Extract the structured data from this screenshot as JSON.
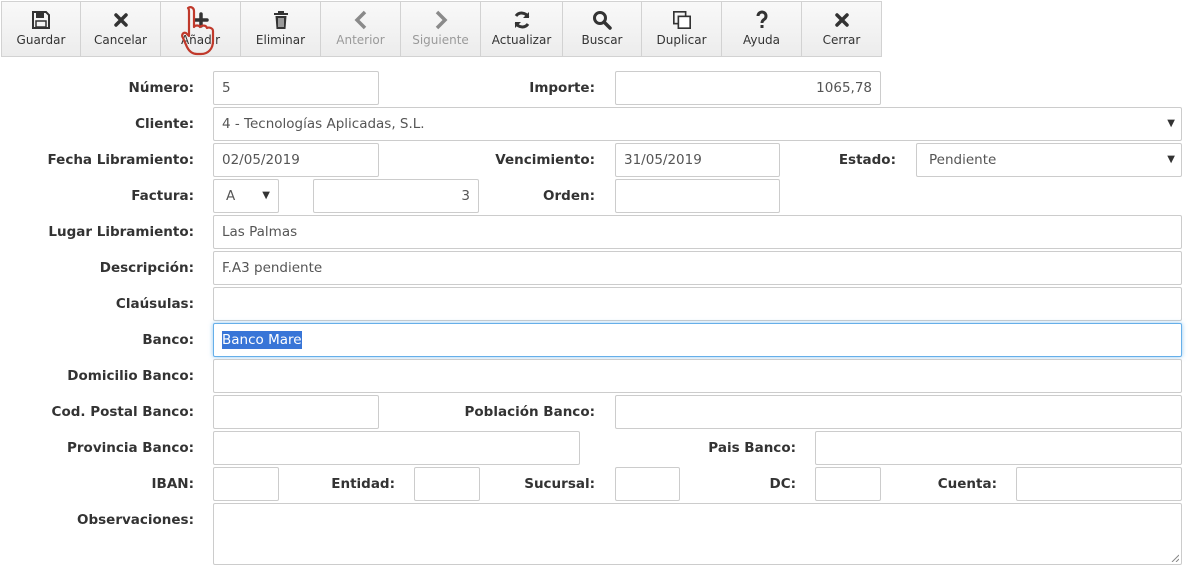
{
  "toolbar": {
    "buttons": [
      {
        "label": "Guardar",
        "icon": "save-icon",
        "enabled": true
      },
      {
        "label": "Cancelar",
        "icon": "close-icon",
        "enabled": true
      },
      {
        "label": "Añadir",
        "icon": "plus-icon",
        "enabled": true
      },
      {
        "label": "Eliminar",
        "icon": "trash-icon",
        "enabled": true
      },
      {
        "label": "Anterior",
        "icon": "chevron-left-icon",
        "enabled": false
      },
      {
        "label": "Siguiente",
        "icon": "chevron-right-icon",
        "enabled": false
      },
      {
        "label": "Actualizar",
        "icon": "refresh-icon",
        "enabled": true
      },
      {
        "label": "Buscar",
        "icon": "search-icon",
        "enabled": true
      },
      {
        "label": "Duplicar",
        "icon": "copy-icon",
        "enabled": true
      },
      {
        "label": "Ayuda",
        "icon": "question-icon",
        "enabled": true
      },
      {
        "label": "Cerrar",
        "icon": "close-icon",
        "enabled": true
      }
    ]
  },
  "form": {
    "numero": {
      "label": "Número:",
      "value": "5"
    },
    "importe": {
      "label": "Importe:",
      "value": "1065,78"
    },
    "cliente": {
      "label": "Cliente:",
      "value": "4 - Tecnologías Aplicadas, S.L."
    },
    "fecha_libramiento": {
      "label": "Fecha Libramiento:",
      "value": "02/05/2019"
    },
    "vencimiento": {
      "label": "Vencimiento:",
      "value": "31/05/2019"
    },
    "estado": {
      "label": "Estado:",
      "value": "Pendiente"
    },
    "factura": {
      "label": "Factura:",
      "serie": "A",
      "numero": "3"
    },
    "orden": {
      "label": "Orden:",
      "value": ""
    },
    "lugar_libramiento": {
      "label": "Lugar Libramiento:",
      "value": "Las Palmas"
    },
    "descripcion": {
      "label": "Descripción:",
      "value": "F.A3 pendiente"
    },
    "clausulas": {
      "label": "Claúsulas:",
      "value": ""
    },
    "banco": {
      "label": "Banco:",
      "value": "Banco Mare"
    },
    "domicilio_banco": {
      "label": "Domicilio Banco:",
      "value": ""
    },
    "cod_postal_banco": {
      "label": "Cod. Postal Banco:",
      "value": ""
    },
    "poblacion_banco": {
      "label": "Población Banco:",
      "value": ""
    },
    "provincia_banco": {
      "label": "Provincia Banco:",
      "value": ""
    },
    "pais_banco": {
      "label": "Pais Banco:",
      "value": ""
    },
    "iban": {
      "label": "IBAN:",
      "value": ""
    },
    "entidad": {
      "label": "Entidad:",
      "value": ""
    },
    "sucursal": {
      "label": "Sucursal:",
      "value": ""
    },
    "dc": {
      "label": "DC:",
      "value": ""
    },
    "cuenta": {
      "label": "Cuenta:",
      "value": ""
    },
    "observaciones": {
      "label": "Observaciones:",
      "value": ""
    }
  },
  "colors": {
    "selection": "#3875d7",
    "focus_border": "#66afe9",
    "cursor_outline": "#c0392b"
  }
}
